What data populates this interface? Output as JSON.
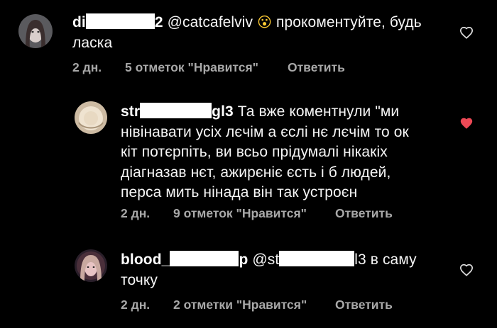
{
  "colors": {
    "background": "#000000",
    "text": "#f5f5f5",
    "meta": "#a8a8a8",
    "like_active": "#ed4956",
    "like_inactive": "#e0e0e0"
  },
  "comments": [
    {
      "username_start": "di",
      "username_end": "2",
      "mention": "@catcafelviv",
      "emoji": "😮",
      "text_line1": "прокоментуйте, будь",
      "text_line2": "ласка",
      "time": "2 дн.",
      "likes": "5 отметок \"Нравится\"",
      "reply": "Ответить",
      "liked": false,
      "like_icon": "heart-outline-icon"
    },
    {
      "username_start": "str",
      "username_end": "gl3",
      "text_line1": "Та вже коментнули \"ми",
      "text_line2": "нівінавати усіх лєчім а єслі нє лєчім то ок",
      "text_line3": "кіт потєрпіть, ви всьо прідумалі нікакіх",
      "text_line4": "діагназав нєт, ажирєніє єсть і б людей,",
      "text_line5": "перса мить нінада він так устроєн",
      "time": "2 дн.",
      "likes": "9 отметок \"Нравится\"",
      "reply": "Ответить",
      "liked": true,
      "like_icon": "heart-filled-icon"
    },
    {
      "username_start": "blood_",
      "username_end": "p",
      "mention_start": "@st",
      "mention_end": "l3",
      "text_line1": "в саму",
      "text_line2": "точку",
      "time": "2 дн.",
      "likes": "2 отметки \"Нравится\"",
      "reply": "Ответить",
      "liked": false,
      "like_icon": "heart-outline-icon"
    }
  ]
}
